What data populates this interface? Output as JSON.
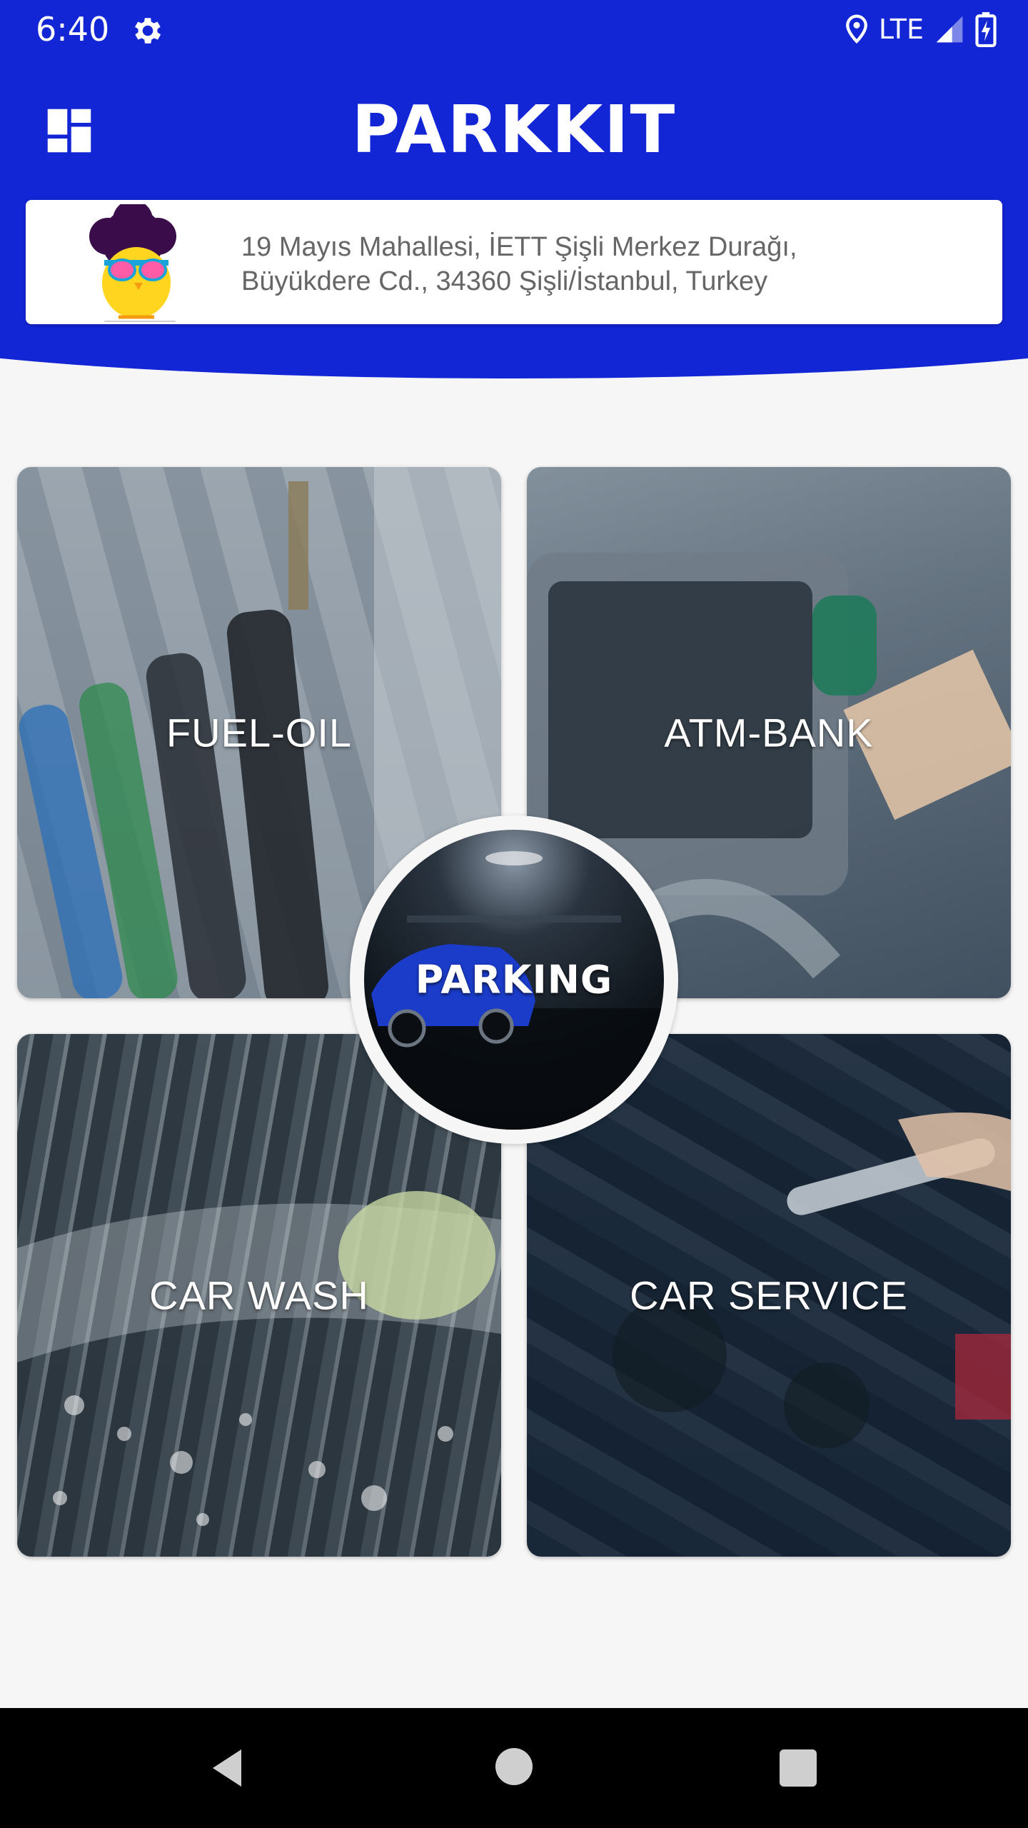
{
  "status_bar": {
    "time": "6:40",
    "network": "LTE"
  },
  "app_bar": {
    "title": "PARKKIT"
  },
  "address_card": {
    "line1": "19 Mayıs Mahallesi, İETT Şişli Merkez Durağı,",
    "line2": "Büyükdere Cd., 34360 Şişli/İstanbul, Turkey"
  },
  "tiles": {
    "fuel": "FUEL-OIL",
    "atm": "ATM-BANK",
    "parking": "PARKING",
    "wash": "CAR WASH",
    "service": "CAR SERVICE"
  },
  "colors": {
    "primary": "#1326d6",
    "background": "#f6f6f6",
    "address_text": "#666666"
  },
  "icons": {
    "status_settings": "gear-icon",
    "status_location": "location-pin-icon",
    "status_signal": "signal-icon",
    "status_battery": "battery-charging-icon",
    "menu": "dashboard-icon",
    "nav_back": "back-triangle-icon",
    "nav_home": "home-circle-icon",
    "nav_recent": "recent-apps-square-icon"
  }
}
